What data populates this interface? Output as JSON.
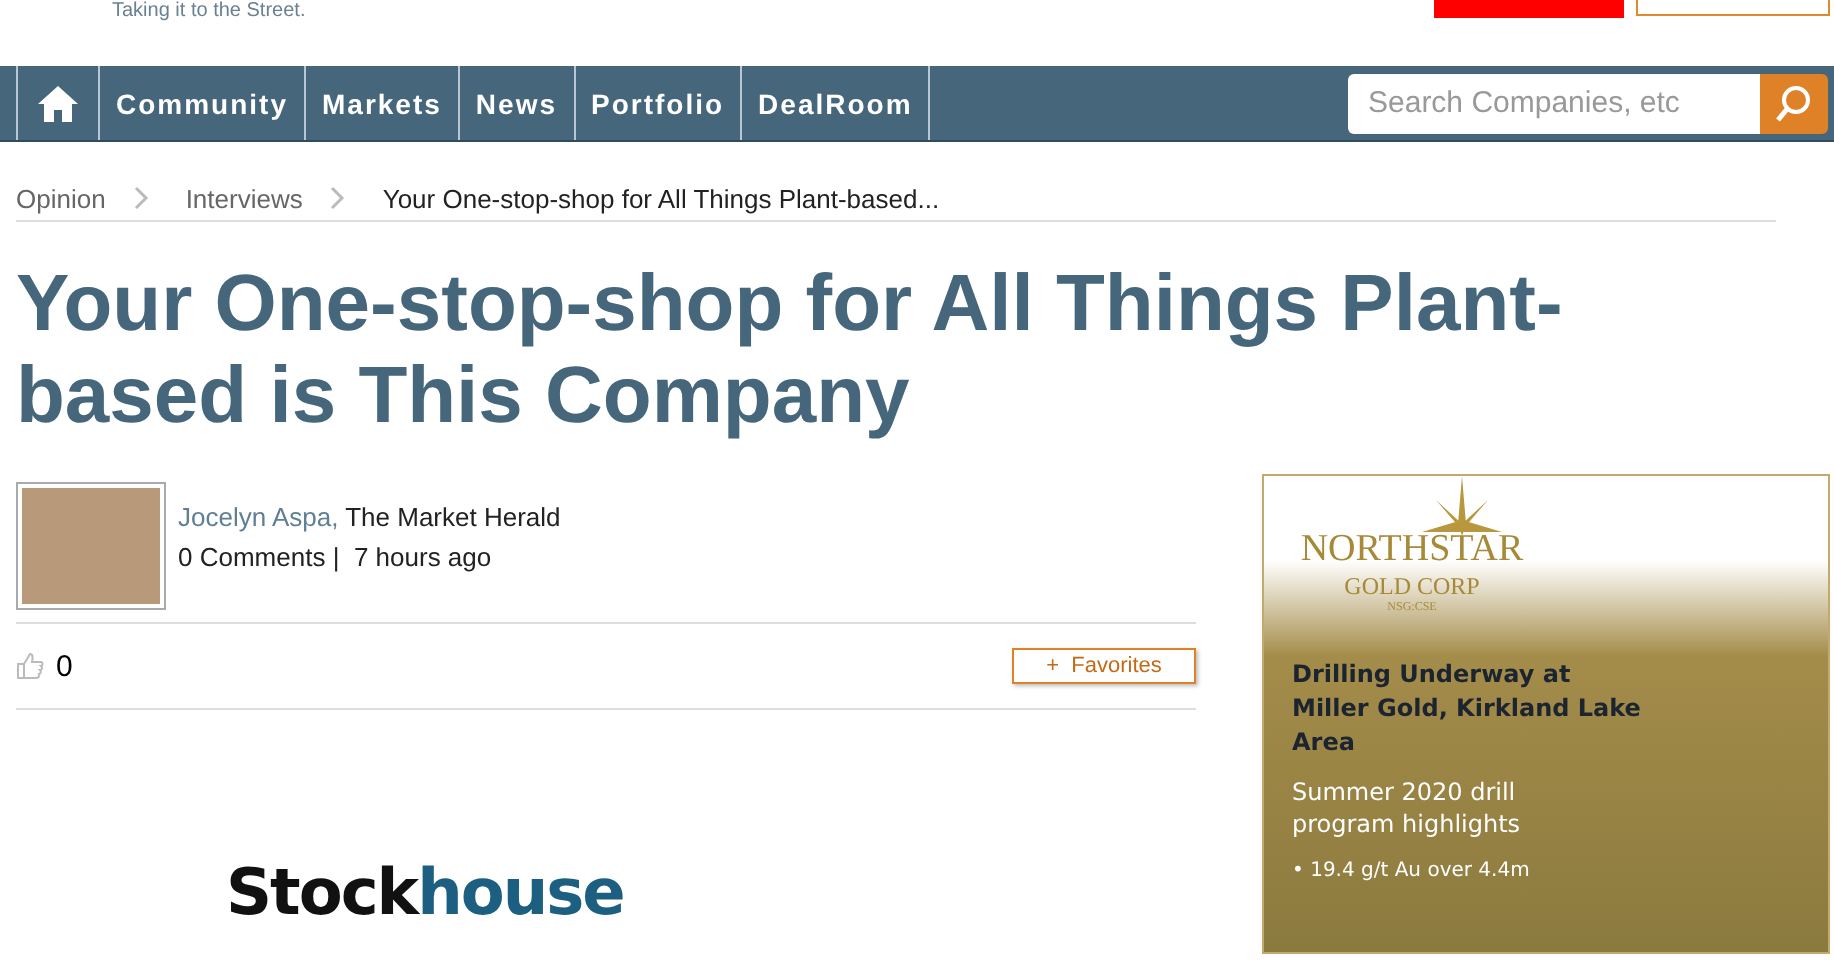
{
  "header": {
    "tagline": "Taking it to the Street."
  },
  "nav": {
    "items": [
      {
        "label": "Community",
        "selected": false
      },
      {
        "label": "Markets",
        "selected": false
      },
      {
        "label": "News",
        "selected": false
      },
      {
        "label": "Portfolio",
        "selected": false
      },
      {
        "label": "DealRoom",
        "selected": false
      }
    ],
    "search": {
      "placeholder": "Search Companies, etc"
    }
  },
  "breadcrumbs": [
    "Opinion",
    "Interviews",
    "Your One-stop-shop for All Things Plant-based..."
  ],
  "article": {
    "title": "Your One-stop-shop for All Things Plant-based is This Company",
    "author": "Jocelyn Aspa,",
    "publisher": "The Market Herald",
    "comments": "0 Comments",
    "separator": "|",
    "time": "7 hours ago",
    "likes": "0",
    "favorites": "+  Favorites",
    "logo_start": "Stock",
    "logo_end": "house"
  },
  "ad": {
    "brand": "NORTHSTAR",
    "brand_sub": "GOLD CORP",
    "ticker": "NSG:CSE",
    "headline": "Drilling Underway at Miller Gold, Kirkland Lake Area",
    "subhead": "Summer 2020 drill program highlights",
    "bullet": "• 19.4 g/t Au over 4.4m"
  }
}
